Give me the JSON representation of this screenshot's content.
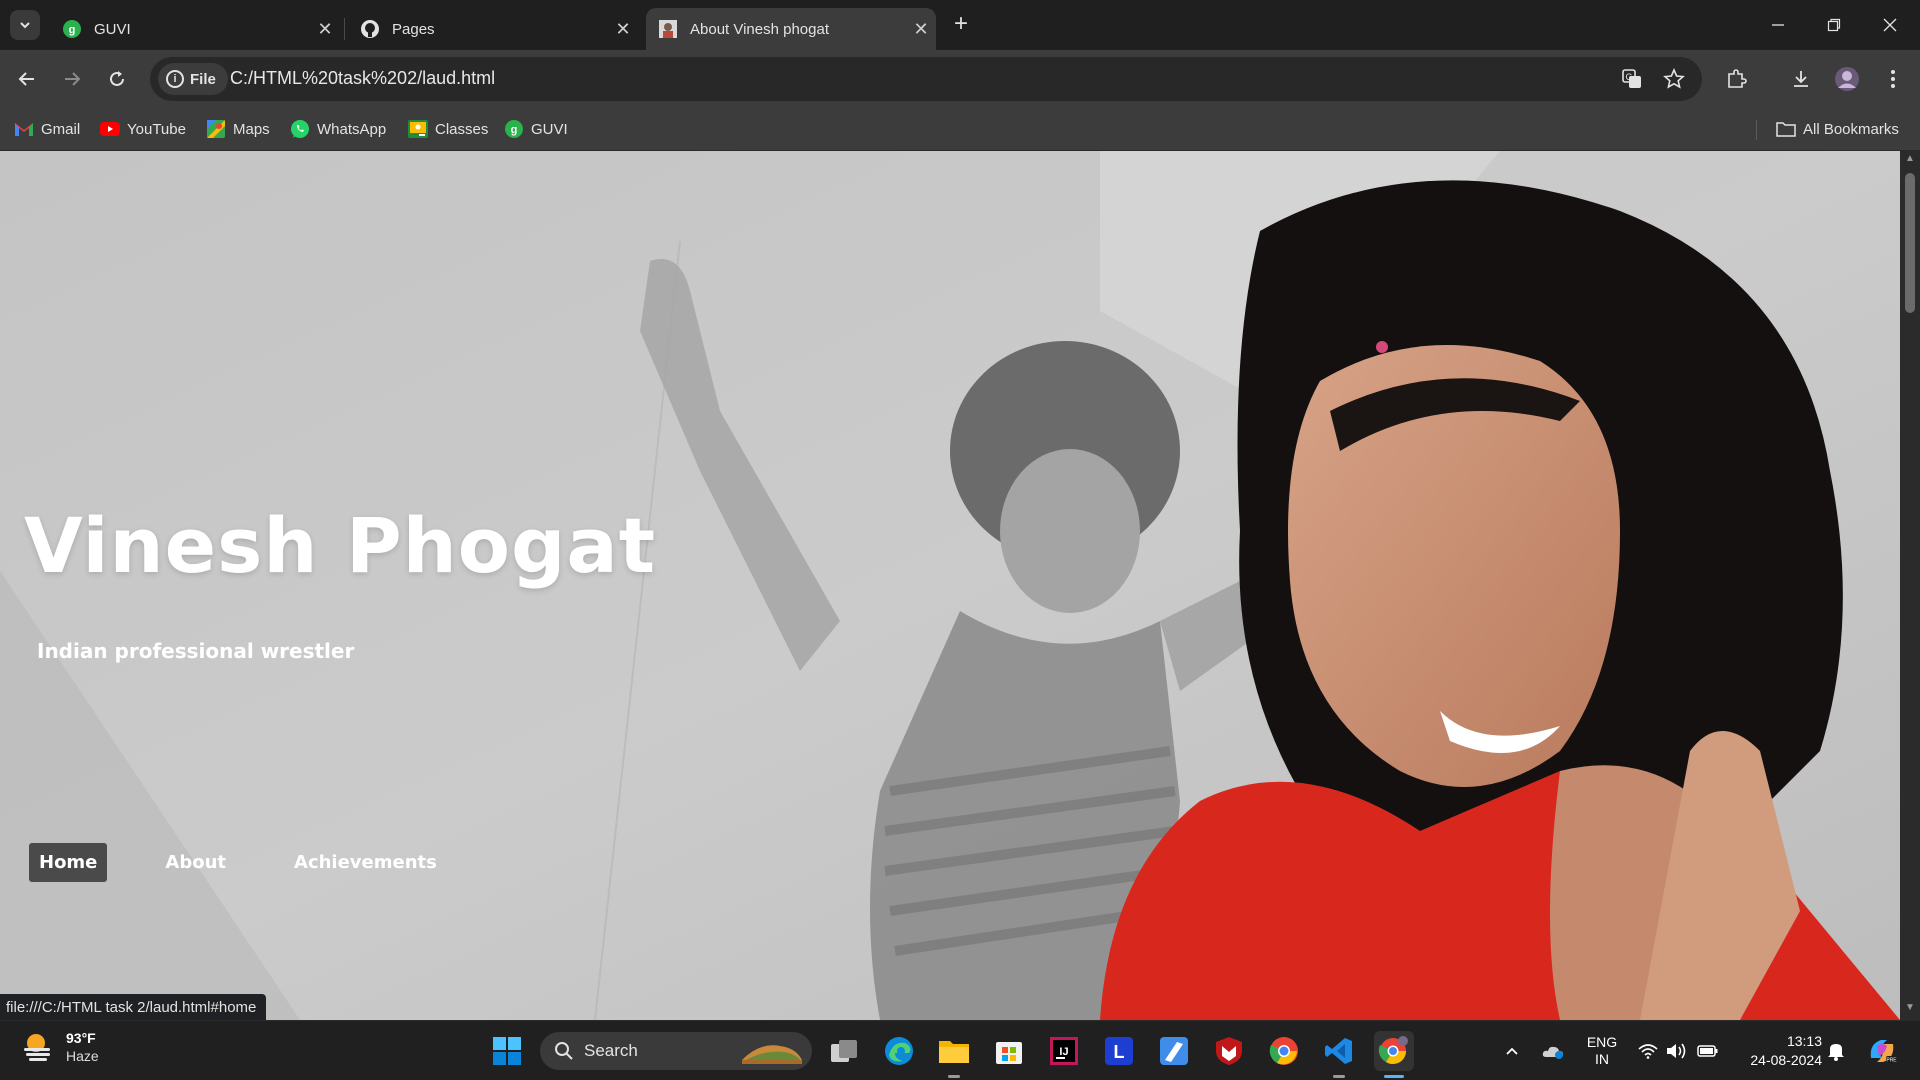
{
  "browser": {
    "tabs": [
      {
        "label": "GUVI",
        "active": false
      },
      {
        "label": "Pages",
        "active": false
      },
      {
        "label": "About Vinesh phogat",
        "active": true
      }
    ],
    "new_tab_symbol": "+",
    "address": {
      "scheme_chip": "File",
      "url": "C:/HTML%20task%202/laud.html"
    },
    "bookmarks": [
      {
        "label": "Gmail",
        "icon": "gmail-icon"
      },
      {
        "label": "YouTube",
        "icon": "youtube-icon"
      },
      {
        "label": "Maps",
        "icon": "maps-icon"
      },
      {
        "label": "WhatsApp",
        "icon": "whatsapp-icon"
      },
      {
        "label": "Classes",
        "icon": "classroom-icon"
      },
      {
        "label": "GUVI",
        "icon": "guvi-icon"
      }
    ],
    "all_bookmarks_label": "All Bookmarks",
    "status_url": "file:///C:/HTML task 2/laud.html#home"
  },
  "page": {
    "title": "Vinesh Phogat",
    "subtitle": "Indian professional wrestler",
    "nav": [
      {
        "label": "Home",
        "active": true
      },
      {
        "label": "About",
        "active": false
      },
      {
        "label": "Achievements",
        "active": false
      }
    ]
  },
  "taskbar": {
    "weather": {
      "temp": "93°F",
      "condition": "Haze"
    },
    "search_placeholder": "Search",
    "language": {
      "line1": "ENG",
      "line2": "IN"
    },
    "clock": {
      "time": "13:13",
      "date": "24-08-2024"
    }
  },
  "colors": {
    "chrome_dark": "#1f1f1f",
    "toolbar": "#3c3c3c",
    "page_bg": "#c8c8c8",
    "nav_active_bg": "#4a4a4a",
    "jersey_red": "#d8281e",
    "taskbar": "#202020"
  }
}
